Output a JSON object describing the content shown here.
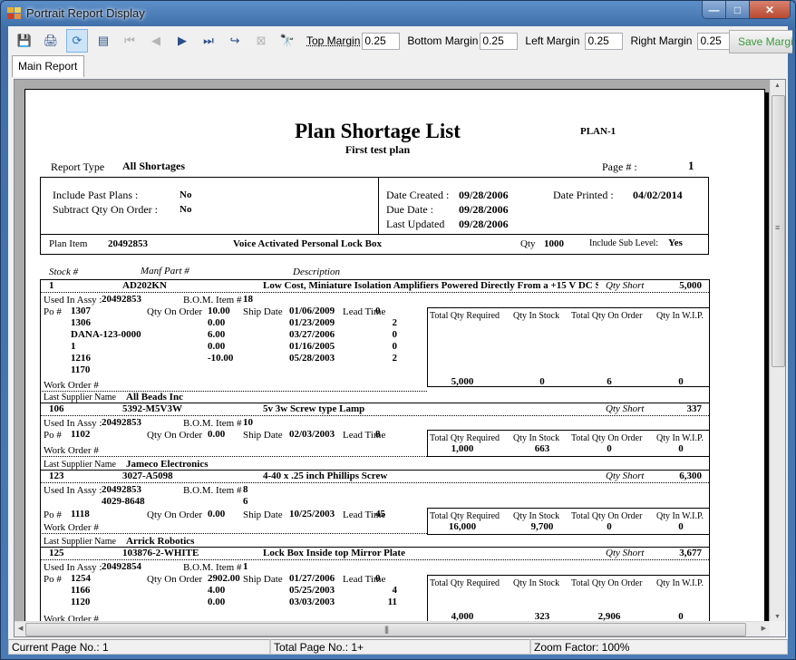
{
  "window": {
    "title": "Portrait Report Display",
    "minimize": "—",
    "maximize": "□",
    "close": "✕"
  },
  "toolbar": {
    "buttons": [
      {
        "name": "export-icon",
        "glyph": "💾",
        "enabled": true
      },
      {
        "name": "print-icon",
        "glyph": "🖨",
        "enabled": true
      },
      {
        "name": "refresh-icon",
        "glyph": "⟳",
        "enabled": true,
        "active": true
      },
      {
        "name": "group-tree-icon",
        "glyph": "▤",
        "enabled": true
      },
      {
        "name": "first-page-icon",
        "glyph": "⏮",
        "enabled": false
      },
      {
        "name": "previous-page-icon",
        "glyph": "◀",
        "enabled": false
      },
      {
        "name": "next-page-icon",
        "glyph": "▶",
        "enabled": true
      },
      {
        "name": "last-page-icon",
        "glyph": "⏭",
        "enabled": true
      },
      {
        "name": "goto-page-icon",
        "glyph": "↪",
        "enabled": true
      },
      {
        "name": "stop-icon",
        "glyph": "⊠",
        "enabled": false
      },
      {
        "name": "find-icon",
        "glyph": "🔭",
        "enabled": true
      }
    ],
    "top_margin_label": "Top Margin",
    "top_margin": "0.25",
    "bottom_margin_label": "Bottom Margin",
    "bottom_margin": "0.25",
    "left_margin_label": "Left Margin",
    "left_margin": "0.25",
    "right_margin_label": "Right Margin",
    "right_margin": "0.25",
    "save_label": "Save Margins"
  },
  "tabs": [
    {
      "label": "Main Report"
    }
  ],
  "report": {
    "title": "Plan Shortage List",
    "subtitle": "First test plan",
    "plan_code": "PLAN-1",
    "report_type_label": "Report Type",
    "report_type": "All Shortages",
    "page_label": "Page # :",
    "page": "1",
    "include_past_label": "Include Past Plans :",
    "include_past": "No",
    "subtract_label": "Subtract Qty On Order :",
    "subtract": "No",
    "date_created_label": "Date Created :",
    "date_created": "09/28/2006",
    "due_date_label": "Due Date :",
    "due_date": "09/28/2006",
    "last_updated_label": "Last Updated",
    "last_updated": "09/28/2006",
    "date_printed_label": "Date Printed :",
    "date_printed": "04/02/2014",
    "plan_item_label": "Plan Item",
    "plan_item": "20492853",
    "plan_item_desc": "Voice Activated Personal Lock Box",
    "qty_label": "Qty",
    "qty": "1000",
    "sub_level_label": "Include Sub Level:",
    "sub_level": "Yes",
    "col_stock": "Stock #",
    "col_manf": "Manf Part #",
    "col_desc": "Description",
    "lbl_qty_short": "Qty Short",
    "lbl_used_in": "Used In Assy :",
    "lbl_bom": "B.O.M. Item #",
    "lbl_po": "Po #",
    "lbl_qoo": "Qty On Order",
    "lbl_ship": "Ship Date",
    "lbl_lead": "Lead Time",
    "lbl_wo": "Work Order #",
    "lbl_supplier": "Last Supplier Name",
    "sum_headers": [
      "Total Qty Required",
      "Qty In Stock",
      "Total Qty On Order",
      "Qty In W.I.P."
    ],
    "items": [
      {
        "stock": "1",
        "manf": "AD202KN",
        "desc": "Low Cost, Miniature Isolation Amplifiers Powered Directly From a +15 V DC S",
        "qty_short": "5,000",
        "used_in": [
          "20492853"
        ],
        "bom": [
          "18"
        ],
        "pos": [
          {
            "po": "1307",
            "qoo": "10.00",
            "ship": "01/06/2009",
            "lead": "0"
          },
          {
            "po": "1306",
            "qoo": "0.00",
            "ship": "01/23/2009",
            "lead": "2"
          },
          {
            "po": "DANA-123-0000",
            "qoo": "6.00",
            "ship": "03/27/2006",
            "lead": "0"
          },
          {
            "po": "1",
            "qoo": "0.00",
            "ship": "01/16/2005",
            "lead": "0"
          },
          {
            "po": "1216",
            "qoo": "-10.00",
            "ship": "05/28/2003",
            "lead": "2"
          },
          {
            "po": "1170",
            "qoo": "",
            "ship": "",
            "lead": ""
          }
        ],
        "sum": [
          "5,000",
          "0",
          "6",
          "0"
        ],
        "supplier": "All Beads Inc"
      },
      {
        "stock": "106",
        "manf": "5392-M5V3W",
        "desc": "5v 3w Screw type Lamp",
        "qty_short": "337",
        "used_in": [
          "20492853"
        ],
        "bom": [
          "10"
        ],
        "pos": [
          {
            "po": "1102",
            "qoo": "0.00",
            "ship": "02/03/2003",
            "lead": "8"
          }
        ],
        "sum": [
          "1,000",
          "663",
          "0",
          "0"
        ],
        "supplier": "Jameco Electronics"
      },
      {
        "stock": "123",
        "manf": "3027-A5098",
        "desc": "4-40 x .25 inch Phillips Screw",
        "qty_short": "6,300",
        "used_in": [
          "20492853",
          "4029-8648"
        ],
        "bom": [
          "8",
          "6"
        ],
        "pos": [
          {
            "po": "1118",
            "qoo": "0.00",
            "ship": "10/25/2003",
            "lead": "45"
          }
        ],
        "sum": [
          "16,000",
          "9,700",
          "0",
          "0"
        ],
        "supplier": "Arrick Robotics"
      },
      {
        "stock": "125",
        "manf": "103876-2-WHITE",
        "desc": "Lock Box Inside top Mirror Plate",
        "qty_short": "3,677",
        "used_in": [
          "20492854"
        ],
        "bom": [
          "1"
        ],
        "pos": [
          {
            "po": "1254",
            "qoo": "2902.00",
            "ship": "01/27/2006",
            "lead": "0"
          },
          {
            "po": "1166",
            "qoo": "4.00",
            "ship": "05/25/2003",
            "lead": "4"
          },
          {
            "po": "1120",
            "qoo": "0.00",
            "ship": "03/03/2003",
            "lead": "11"
          }
        ],
        "sum": [
          "4,000",
          "323",
          "2,906",
          "0"
        ],
        "supplier": ""
      }
    ]
  },
  "status": {
    "current_page": "Current Page No.: 1",
    "total_page": "Total Page No.: 1+",
    "zoom": "Zoom Factor: 100%"
  }
}
